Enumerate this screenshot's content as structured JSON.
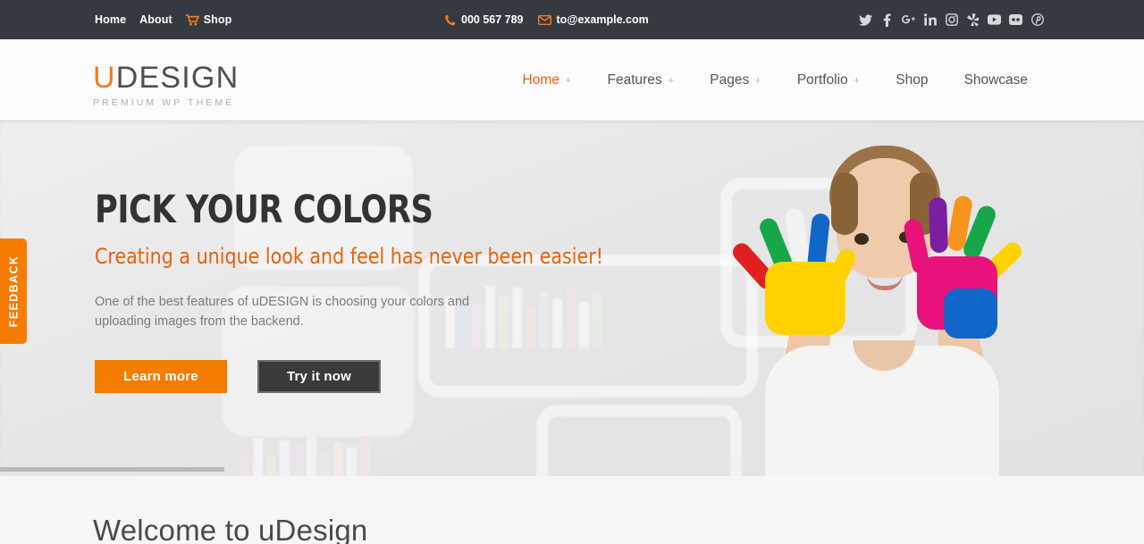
{
  "topbar": {
    "links": [
      {
        "label": "Home",
        "icon": ""
      },
      {
        "label": "About",
        "icon": ""
      },
      {
        "label": "Shop",
        "icon": "cart-icon"
      }
    ],
    "phone": "000 567 789",
    "email": "to@example.com",
    "socials": [
      "twitter-icon",
      "facebook-icon",
      "google-plus-icon",
      "linkedin-icon",
      "instagram-icon",
      "yelp-icon",
      "youtube-icon",
      "flickr-icon",
      "pinterest-icon"
    ],
    "bg_color": "#343a40",
    "accent_color": "#f47b20"
  },
  "header": {
    "logo_u": "U",
    "logo_rest": "DESIGN",
    "logo_tagline": "PREMIUM WP THEME",
    "nav": [
      {
        "label": "Home",
        "has_submenu": true,
        "active": true
      },
      {
        "label": "Features",
        "has_submenu": true,
        "active": false
      },
      {
        "label": "Pages",
        "has_submenu": true,
        "active": false
      },
      {
        "label": "Portfolio",
        "has_submenu": true,
        "active": false
      },
      {
        "label": "Shop",
        "has_submenu": false,
        "active": false
      },
      {
        "label": "Showcase",
        "has_submenu": false,
        "active": false
      }
    ],
    "submenu_indicator": "+",
    "active_color": "#e8620c"
  },
  "slider": {
    "title": "PICK YOUR COLORS",
    "subtitle": "Creating a unique look and feel has never been easier!",
    "body": "One of the best features of uDESIGN is choosing your colors and uploading images from the backend.",
    "primary_button": "Learn more",
    "secondary_button": "Try it now",
    "primary_color": "#f57c00",
    "secondary_color": "#3a3a3a",
    "progress_percent": 20
  },
  "feedback_tab": {
    "label": "FEEDBACK",
    "color": "#f57c00"
  },
  "below_section": {
    "title": "Welcome to uDesign"
  }
}
